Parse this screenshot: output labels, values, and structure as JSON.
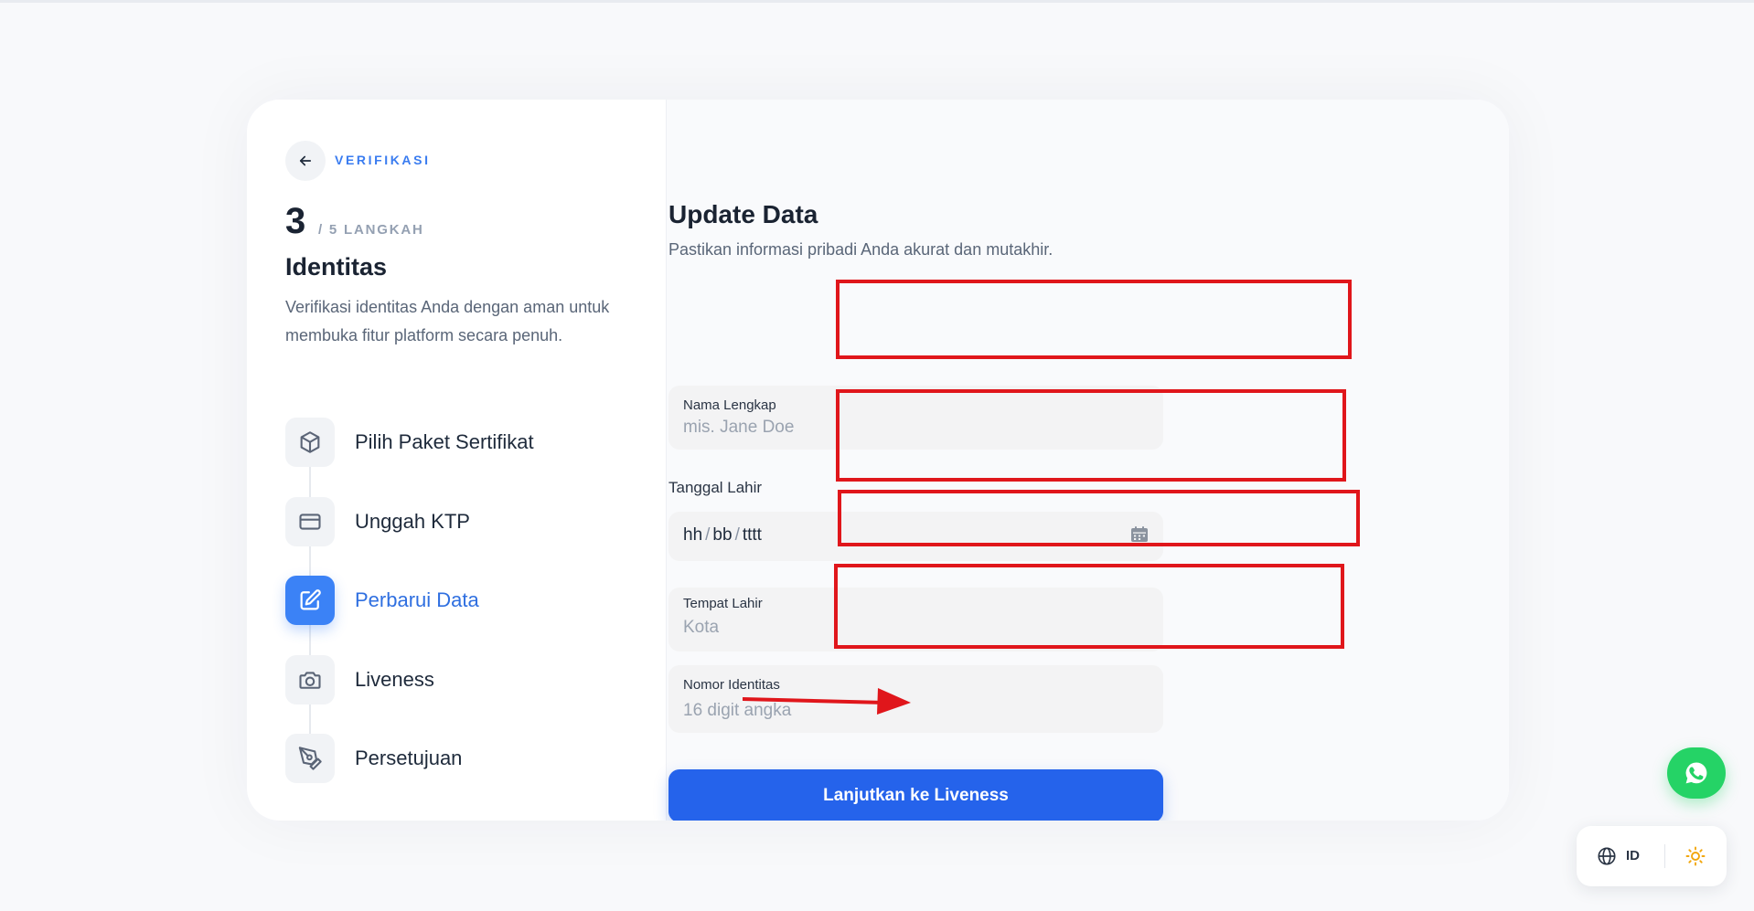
{
  "sidebar": {
    "back_label": "VERIFIKASI",
    "step_current": "3",
    "step_total": "/ 5 LANGKAH",
    "title": "Identitas",
    "description": "Verifikasi identitas Anda dengan aman untuk membuka fitur platform secara penuh.",
    "steps": [
      {
        "label": "Pilih Paket Sertifikat",
        "icon": "package-icon",
        "active": false
      },
      {
        "label": "Unggah KTP",
        "icon": "card-icon",
        "active": false
      },
      {
        "label": "Perbarui Data",
        "icon": "edit-icon",
        "active": true
      },
      {
        "label": "Liveness",
        "icon": "camera-icon",
        "active": false
      },
      {
        "label": "Persetujuan",
        "icon": "pen-tool-icon",
        "active": false
      }
    ]
  },
  "form": {
    "title": "Update Data",
    "subtitle": "Pastikan informasi pribadi Anda akurat dan mutakhir.",
    "full_name": {
      "label": "Nama Lengkap",
      "placeholder": "mis. Jane Doe",
      "value": ""
    },
    "birth_date": {
      "label": "Tanggal Lahir",
      "day": "hh",
      "month": "bb",
      "year": "tttt",
      "sep": "/"
    },
    "birth_place": {
      "label": "Tempat Lahir",
      "placeholder": "Kota",
      "value": ""
    },
    "id_number": {
      "label": "Nomor Identitas",
      "placeholder": "16 digit angka",
      "value": ""
    },
    "submit_label": "Lanjutkan ke Liveness"
  },
  "preferences": {
    "language": "ID"
  },
  "colors": {
    "accent": "#2563eb",
    "annotation": "#e0161b",
    "whatsapp": "#25d366"
  }
}
